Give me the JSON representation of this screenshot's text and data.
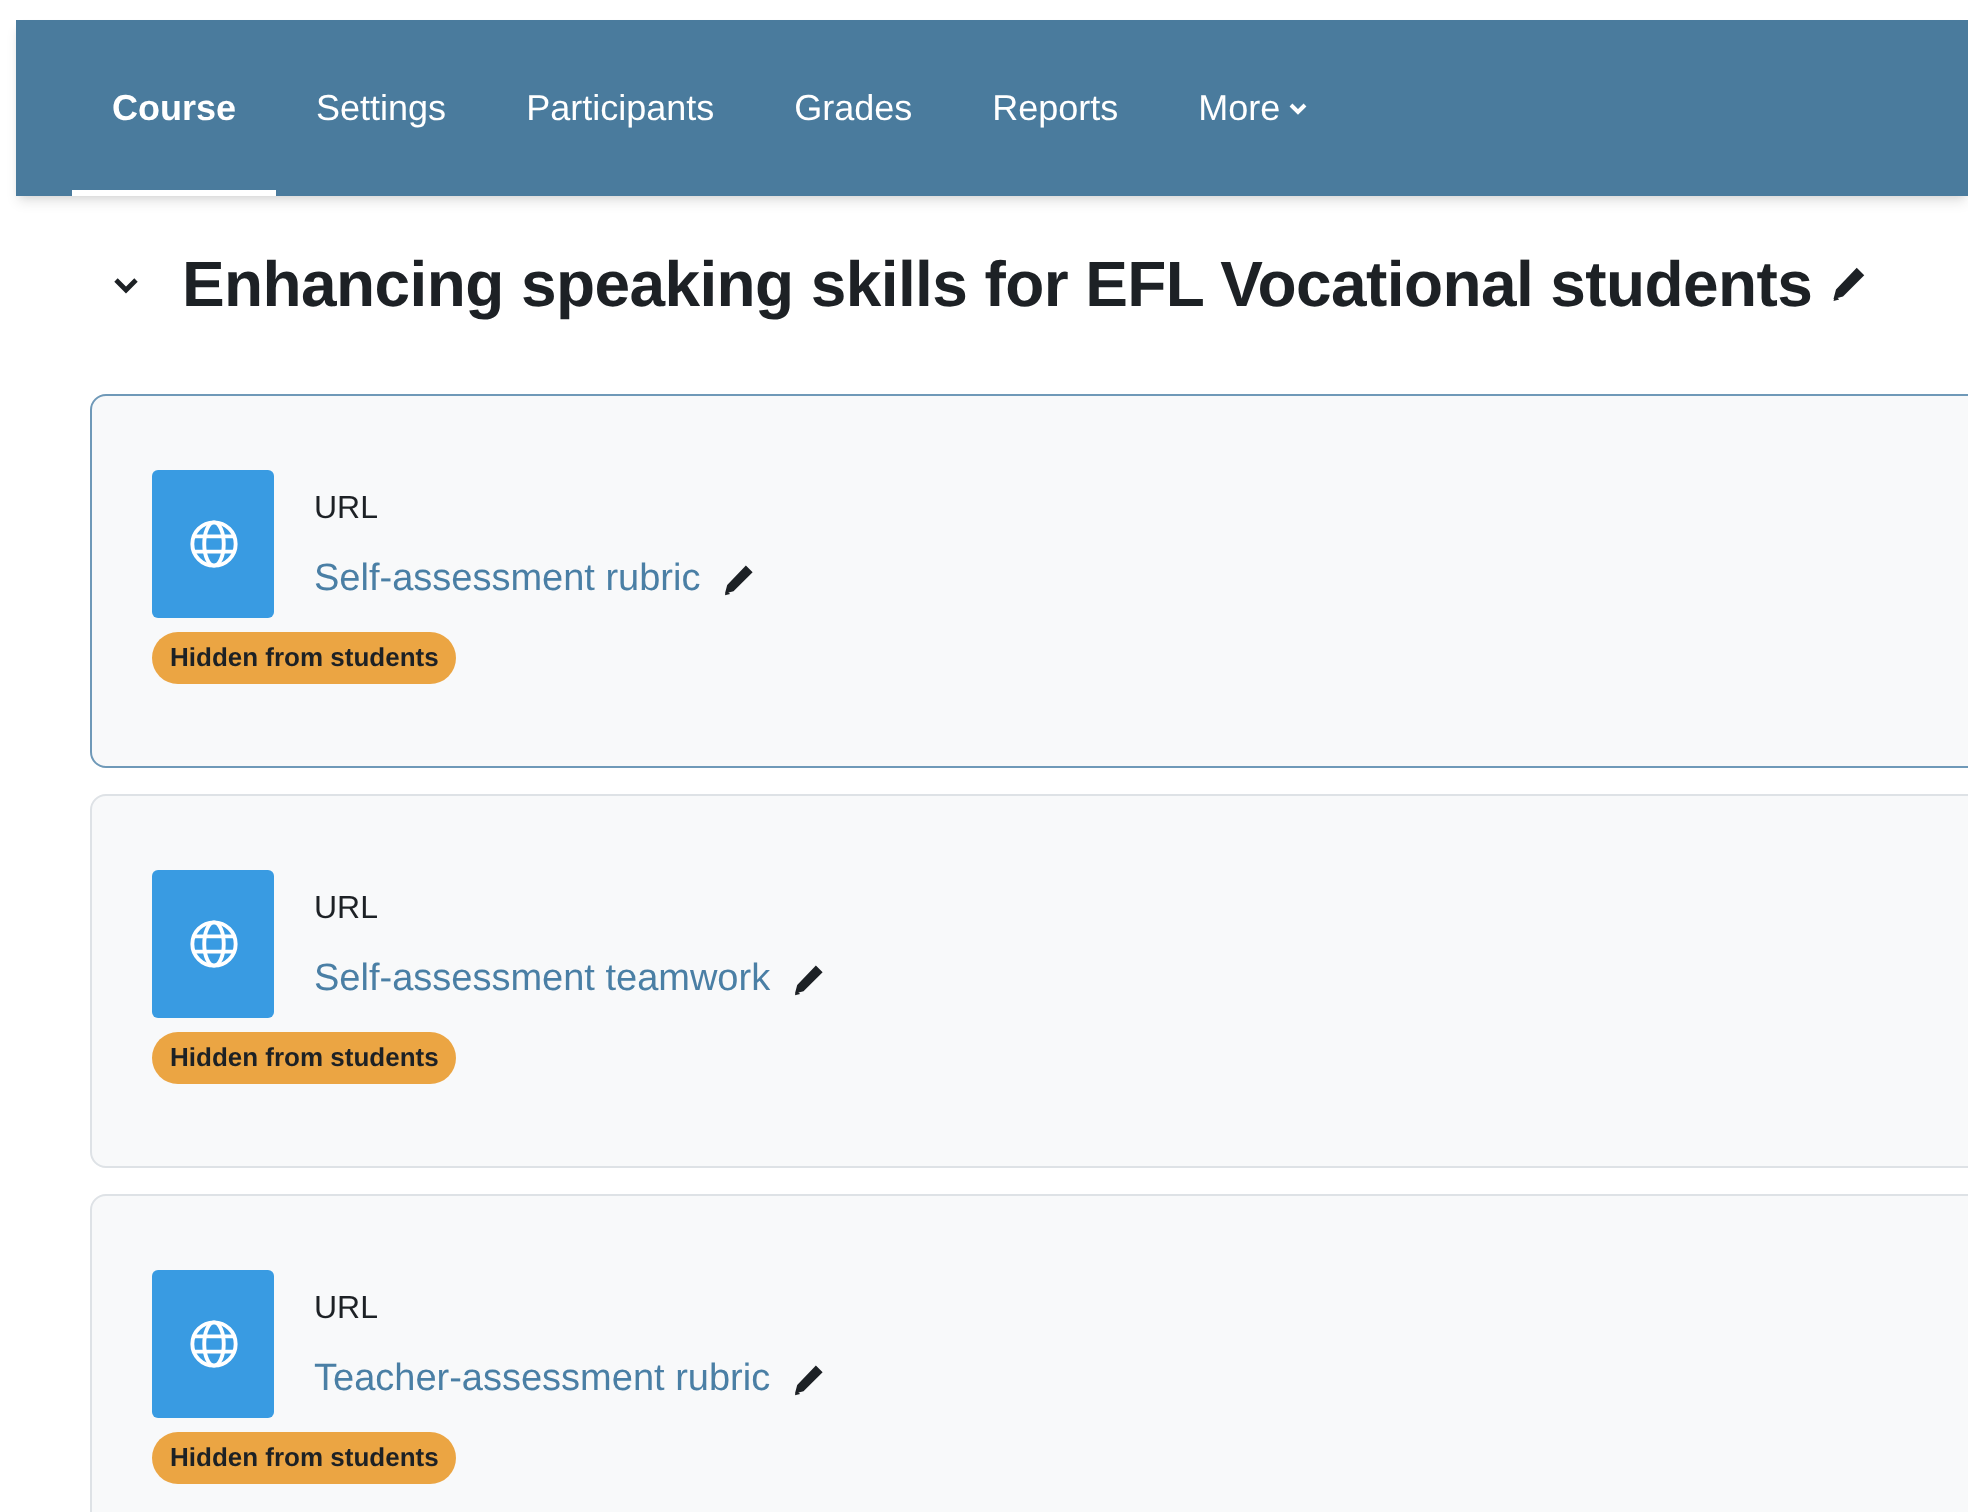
{
  "tabs": [
    {
      "label": "Course",
      "selected": true
    },
    {
      "label": "Settings",
      "selected": false
    },
    {
      "label": "Participants",
      "selected": false
    },
    {
      "label": "Grades",
      "selected": false
    },
    {
      "label": "Reports",
      "selected": false
    },
    {
      "label": "More",
      "selected": false,
      "dropdown": true
    }
  ],
  "section": {
    "title": "Enhancing speaking skills for EFL Vocational students",
    "expanded": true
  },
  "activities": [
    {
      "type": "URL",
      "name": "Self-assessment rubric",
      "badge": "Hidden from students",
      "highlighted": true
    },
    {
      "type": "URL",
      "name": "Self-assessment teamwork",
      "badge": "Hidden from students",
      "highlighted": false
    },
    {
      "type": "URL",
      "name": "Teacher-assessment rubric",
      "badge": "Hidden from students",
      "highlighted": false
    }
  ]
}
